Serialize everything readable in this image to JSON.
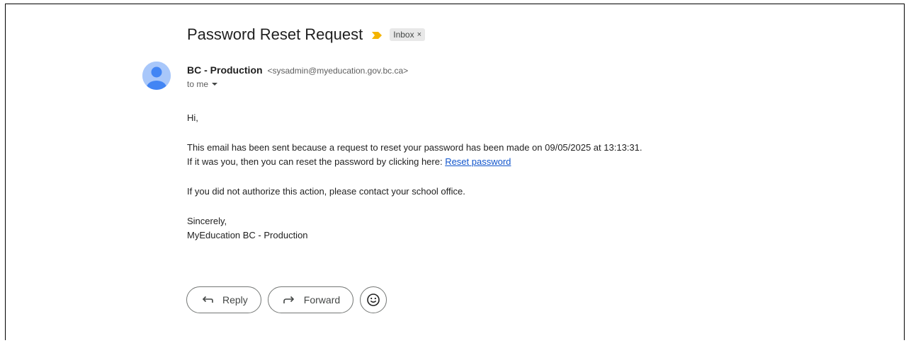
{
  "email": {
    "subject": "Password Reset Request",
    "label": "Inbox",
    "label_close": "×",
    "sender_name": "BC - Production",
    "sender_email": "<sysadmin@myeducation.gov.bc.ca>",
    "recipient": "to me",
    "body": {
      "greeting": "Hi,",
      "line1": "This email has been sent because a request to reset your password has been made on 09/05/2025 at 13:13:31.",
      "line2_prefix": "If it was you, then you can reset the password by clicking here: ",
      "link_text": "Reset password",
      "line3": "If you did not authorize this action, please contact your school office.",
      "signoff": "Sincerely,",
      "signature": "MyEducation BC - Production"
    }
  },
  "actions": {
    "reply_label": "Reply",
    "forward_label": "Forward"
  },
  "icons": {
    "important": "important-marker-icon",
    "reply": "reply-arrow-icon",
    "forward": "forward-arrow-icon",
    "emoji": "emoji-smile-icon",
    "avatar": "default-person-icon"
  },
  "colors": {
    "important_marker": "#f4b400",
    "avatar_bg": "#a8c7fa",
    "avatar_fg": "#4285f4",
    "link": "#1155cc"
  }
}
